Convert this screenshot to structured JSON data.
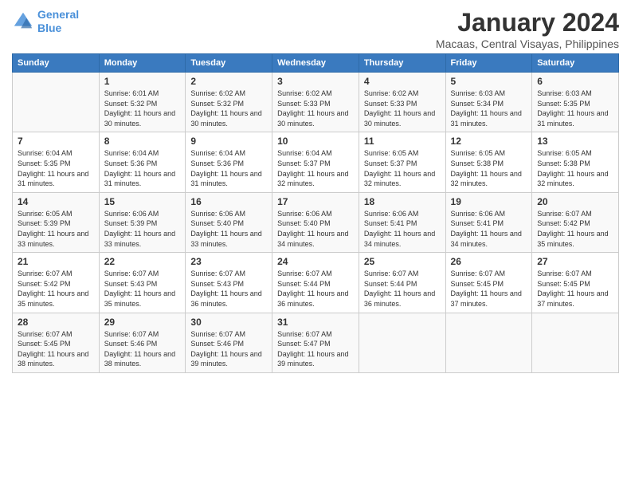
{
  "header": {
    "logo_line1": "General",
    "logo_line2": "Blue",
    "month": "January 2024",
    "location": "Macaas, Central Visayas, Philippines"
  },
  "columns": [
    "Sunday",
    "Monday",
    "Tuesday",
    "Wednesday",
    "Thursday",
    "Friday",
    "Saturday"
  ],
  "weeks": [
    [
      {
        "day": "",
        "sunrise": "",
        "sunset": "",
        "daylight": ""
      },
      {
        "day": "1",
        "sunrise": "Sunrise: 6:01 AM",
        "sunset": "Sunset: 5:32 PM",
        "daylight": "Daylight: 11 hours and 30 minutes."
      },
      {
        "day": "2",
        "sunrise": "Sunrise: 6:02 AM",
        "sunset": "Sunset: 5:32 PM",
        "daylight": "Daylight: 11 hours and 30 minutes."
      },
      {
        "day": "3",
        "sunrise": "Sunrise: 6:02 AM",
        "sunset": "Sunset: 5:33 PM",
        "daylight": "Daylight: 11 hours and 30 minutes."
      },
      {
        "day": "4",
        "sunrise": "Sunrise: 6:02 AM",
        "sunset": "Sunset: 5:33 PM",
        "daylight": "Daylight: 11 hours and 30 minutes."
      },
      {
        "day": "5",
        "sunrise": "Sunrise: 6:03 AM",
        "sunset": "Sunset: 5:34 PM",
        "daylight": "Daylight: 11 hours and 31 minutes."
      },
      {
        "day": "6",
        "sunrise": "Sunrise: 6:03 AM",
        "sunset": "Sunset: 5:35 PM",
        "daylight": "Daylight: 11 hours and 31 minutes."
      }
    ],
    [
      {
        "day": "7",
        "sunrise": "Sunrise: 6:04 AM",
        "sunset": "Sunset: 5:35 PM",
        "daylight": "Daylight: 11 hours and 31 minutes."
      },
      {
        "day": "8",
        "sunrise": "Sunrise: 6:04 AM",
        "sunset": "Sunset: 5:36 PM",
        "daylight": "Daylight: 11 hours and 31 minutes."
      },
      {
        "day": "9",
        "sunrise": "Sunrise: 6:04 AM",
        "sunset": "Sunset: 5:36 PM",
        "daylight": "Daylight: 11 hours and 31 minutes."
      },
      {
        "day": "10",
        "sunrise": "Sunrise: 6:04 AM",
        "sunset": "Sunset: 5:37 PM",
        "daylight": "Daylight: 11 hours and 32 minutes."
      },
      {
        "day": "11",
        "sunrise": "Sunrise: 6:05 AM",
        "sunset": "Sunset: 5:37 PM",
        "daylight": "Daylight: 11 hours and 32 minutes."
      },
      {
        "day": "12",
        "sunrise": "Sunrise: 6:05 AM",
        "sunset": "Sunset: 5:38 PM",
        "daylight": "Daylight: 11 hours and 32 minutes."
      },
      {
        "day": "13",
        "sunrise": "Sunrise: 6:05 AM",
        "sunset": "Sunset: 5:38 PM",
        "daylight": "Daylight: 11 hours and 32 minutes."
      }
    ],
    [
      {
        "day": "14",
        "sunrise": "Sunrise: 6:05 AM",
        "sunset": "Sunset: 5:39 PM",
        "daylight": "Daylight: 11 hours and 33 minutes."
      },
      {
        "day": "15",
        "sunrise": "Sunrise: 6:06 AM",
        "sunset": "Sunset: 5:39 PM",
        "daylight": "Daylight: 11 hours and 33 minutes."
      },
      {
        "day": "16",
        "sunrise": "Sunrise: 6:06 AM",
        "sunset": "Sunset: 5:40 PM",
        "daylight": "Daylight: 11 hours and 33 minutes."
      },
      {
        "day": "17",
        "sunrise": "Sunrise: 6:06 AM",
        "sunset": "Sunset: 5:40 PM",
        "daylight": "Daylight: 11 hours and 34 minutes."
      },
      {
        "day": "18",
        "sunrise": "Sunrise: 6:06 AM",
        "sunset": "Sunset: 5:41 PM",
        "daylight": "Daylight: 11 hours and 34 minutes."
      },
      {
        "day": "19",
        "sunrise": "Sunrise: 6:06 AM",
        "sunset": "Sunset: 5:41 PM",
        "daylight": "Daylight: 11 hours and 34 minutes."
      },
      {
        "day": "20",
        "sunrise": "Sunrise: 6:07 AM",
        "sunset": "Sunset: 5:42 PM",
        "daylight": "Daylight: 11 hours and 35 minutes."
      }
    ],
    [
      {
        "day": "21",
        "sunrise": "Sunrise: 6:07 AM",
        "sunset": "Sunset: 5:42 PM",
        "daylight": "Daylight: 11 hours and 35 minutes."
      },
      {
        "day": "22",
        "sunrise": "Sunrise: 6:07 AM",
        "sunset": "Sunset: 5:43 PM",
        "daylight": "Daylight: 11 hours and 35 minutes."
      },
      {
        "day": "23",
        "sunrise": "Sunrise: 6:07 AM",
        "sunset": "Sunset: 5:43 PM",
        "daylight": "Daylight: 11 hours and 36 minutes."
      },
      {
        "day": "24",
        "sunrise": "Sunrise: 6:07 AM",
        "sunset": "Sunset: 5:44 PM",
        "daylight": "Daylight: 11 hours and 36 minutes."
      },
      {
        "day": "25",
        "sunrise": "Sunrise: 6:07 AM",
        "sunset": "Sunset: 5:44 PM",
        "daylight": "Daylight: 11 hours and 36 minutes."
      },
      {
        "day": "26",
        "sunrise": "Sunrise: 6:07 AM",
        "sunset": "Sunset: 5:45 PM",
        "daylight": "Daylight: 11 hours and 37 minutes."
      },
      {
        "day": "27",
        "sunrise": "Sunrise: 6:07 AM",
        "sunset": "Sunset: 5:45 PM",
        "daylight": "Daylight: 11 hours and 37 minutes."
      }
    ],
    [
      {
        "day": "28",
        "sunrise": "Sunrise: 6:07 AM",
        "sunset": "Sunset: 5:45 PM",
        "daylight": "Daylight: 11 hours and 38 minutes."
      },
      {
        "day": "29",
        "sunrise": "Sunrise: 6:07 AM",
        "sunset": "Sunset: 5:46 PM",
        "daylight": "Daylight: 11 hours and 38 minutes."
      },
      {
        "day": "30",
        "sunrise": "Sunrise: 6:07 AM",
        "sunset": "Sunset: 5:46 PM",
        "daylight": "Daylight: 11 hours and 39 minutes."
      },
      {
        "day": "31",
        "sunrise": "Sunrise: 6:07 AM",
        "sunset": "Sunset: 5:47 PM",
        "daylight": "Daylight: 11 hours and 39 minutes."
      },
      {
        "day": "",
        "sunrise": "",
        "sunset": "",
        "daylight": ""
      },
      {
        "day": "",
        "sunrise": "",
        "sunset": "",
        "daylight": ""
      },
      {
        "day": "",
        "sunrise": "",
        "sunset": "",
        "daylight": ""
      }
    ]
  ]
}
